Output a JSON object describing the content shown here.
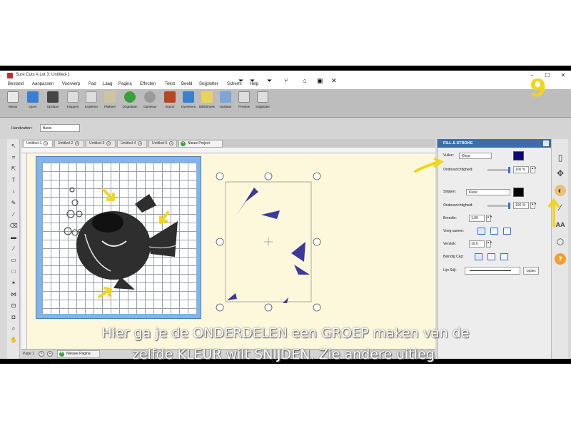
{
  "window": {
    "title": "Sure Cuts A Lot 3: Untitled-1",
    "controls": [
      "−",
      "☐",
      "✕"
    ]
  },
  "menu": [
    "Bestand",
    "Aanpassen",
    "Voorwerp",
    "Pad",
    "Laag",
    "Pagina",
    "Effecten",
    "Tekst",
    "Beeld",
    "Snijplotter",
    "Scherm",
    "Help"
  ],
  "toolbar": [
    "Nieuw",
    "Open",
    "Opslaan",
    "Knippen",
    "Kopiëren",
    "Plakken",
    "Ongedaan",
    "Opnieuw",
    "Import",
    "Overleven",
    "Bibliotheek",
    "Opslaan",
    "Preview",
    "Snijplotter"
  ],
  "options": {
    "label": "Handvatten:",
    "value": "Basis"
  },
  "tabs": [
    "Untitled-1",
    "Untitled-2",
    "Untitled-3",
    "Untitled-4",
    "Untitled-5"
  ],
  "new_project": "Nieuw Project",
  "panel": {
    "title": "FILL & STROKE",
    "fill_label": "Vullen:",
    "fill_value": "Kleur",
    "fill_color": "#0a0a78",
    "opacity_label": "Ondoorzichtigheid:",
    "fill_opacity": "100 %",
    "stroke_label": "Strijken:",
    "stroke_value": "Kleur",
    "stroke_color": "#000000",
    "stroke_opacity_label": "Ondoorzichtigheid:",
    "stroke_opacity": "100 %",
    "width_label": "Breedte:",
    "width_value": "1.00",
    "join_label": "Voeg samen:",
    "miter_label": "Verstek:",
    "miter_value": "10.0",
    "cap_label": "Beindig Cap:",
    "linestyle_label": "Lijn Stijl:",
    "options_button": "Opties"
  },
  "pagebar": {
    "page": "Page 1",
    "new_page": "Nieuwe Pagina"
  },
  "overlay": {
    "step": "9",
    "subtitle_line1": "Hier ga je de ONDERDELEN een GROEP maken van de",
    "subtitle_line2": "zelfde KLEUR wilt SNIJDEN. Zie andere uitleg."
  },
  "colors": {
    "arrow": "#f2d51e",
    "accent": "#3b6ea8",
    "shape": "#3b3a9a",
    "fish": "#2e2e2e"
  }
}
